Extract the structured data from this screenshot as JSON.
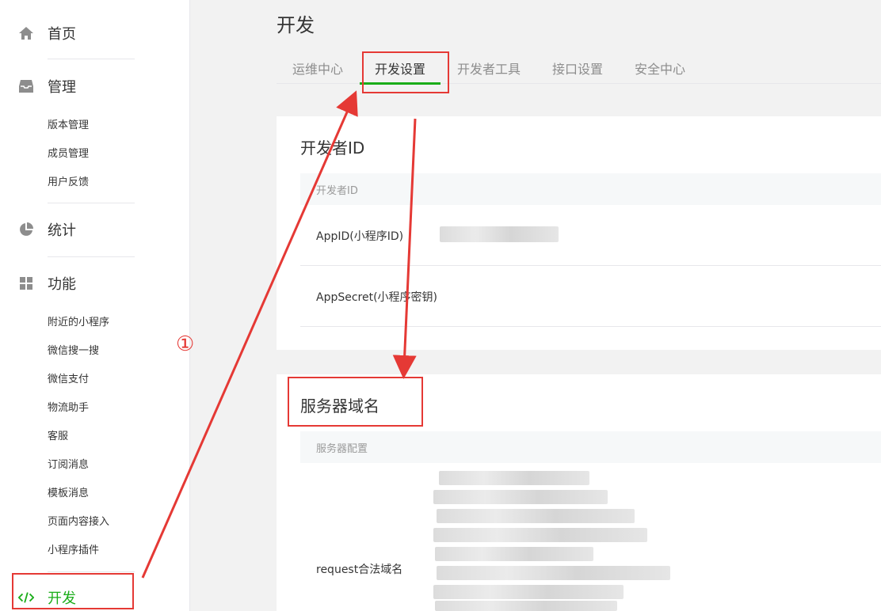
{
  "sidebar": {
    "home": {
      "label": "首页",
      "icon": "home-icon"
    },
    "manage": {
      "label": "管理",
      "icon": "inbox-icon",
      "items": [
        "版本管理",
        "成员管理",
        "用户反馈"
      ]
    },
    "stats": {
      "label": "统计",
      "icon": "pie-chart-icon"
    },
    "features": {
      "label": "功能",
      "icon": "grid-icon",
      "items": [
        "附近的小程序",
        "微信搜一搜",
        "微信支付",
        "物流助手",
        "客服",
        "订阅消息",
        "模板消息",
        "页面内容接入",
        "小程序插件"
      ]
    },
    "develop": {
      "label": "开发",
      "icon": "code-icon"
    }
  },
  "page": {
    "title": "开发",
    "tabs": [
      "运维中心",
      "开发设置",
      "开发者工具",
      "接口设置",
      "安全中心"
    ],
    "active_tab": "开发设置"
  },
  "developer_id": {
    "title": "开发者ID",
    "subheader": "开发者ID",
    "appid_label": "AppID(小程序ID)",
    "appsecret_label": "AppSecret(小程序密钥)"
  },
  "server_domain": {
    "title": "服务器域名",
    "subheader": "服务器配置",
    "request_label": "request合法域名"
  },
  "annotation": {
    "step_number": "①",
    "color": "#e53935"
  },
  "colors": {
    "accent": "#1aad19",
    "annotation": "#e53935"
  }
}
